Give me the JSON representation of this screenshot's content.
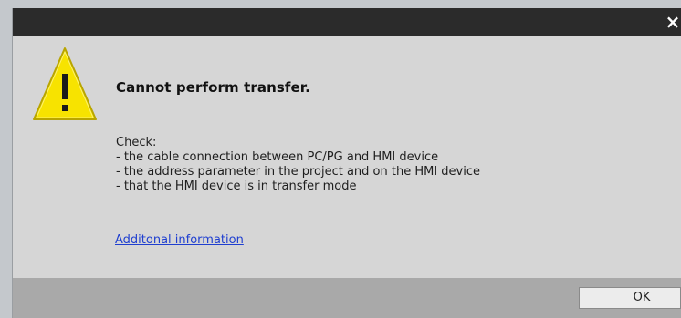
{
  "dialog": {
    "close_glyph": "×",
    "icon": "warning-triangle-icon",
    "icon_colors": {
      "fill": "#f7e300",
      "outline": "#b9a500",
      "mark": "#1a1a1a"
    },
    "heading": "Cannot perform transfer.",
    "message_lines": [
      "Check:",
      "- the cable connection between PC/PG and HMI device",
      "- the address parameter in the project and on the HMI device",
      "- that the HMI device is in transfer mode"
    ],
    "link_text": "Additonal information",
    "ok_label": "OK",
    "colors": {
      "titlebar": "#2b2b2b",
      "body": "#d6d6d6",
      "footer": "#a9a9a9",
      "link": "#1f3fd0"
    }
  }
}
